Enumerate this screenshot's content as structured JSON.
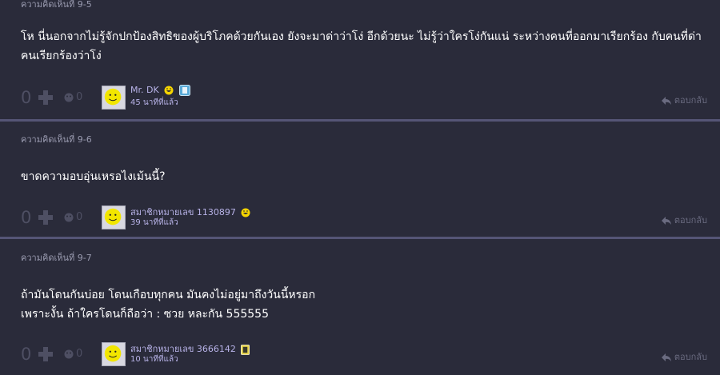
{
  "comments": [
    {
      "label": "ความคิดเห็นที่ 9-5",
      "text_lines": [
        "โห นี่นอกจากไม่รู้จักปกป้องสิทธิของผู้บริโภคด้วยกันเอง ยังจะมาด่าว่าโง่ อีกด้วยนะ ไม่รู้ว่าใครโง่กันแน่ ระหว่างคนที่ออกมาเรียกร้อง กับคนที่ด่า",
        "คนเรียกร้องว่าโง่"
      ],
      "votes": "0",
      "emotions": "0",
      "username": "Mr. DK",
      "timestamp": "45 นาทีที่แล้ว",
      "reply_label": "ตอบกลับ"
    },
    {
      "label": "ความคิดเห็นที่ 9-6",
      "text_lines": [
        "ขาดความอบอุ่นเหรอไงเม้นนี้?"
      ],
      "votes": "0",
      "emotions": "0",
      "username": "สมาชิกหมายเลข 1130897",
      "timestamp": "39 นาทีที่แล้ว",
      "reply_label": "ตอบกลับ"
    },
    {
      "label": "ความคิดเห็นที่ 9-7",
      "text_lines": [
        "ถ้ามันโดนกันบ่อย โดนเกือบทุกคน มันคงไม่อยู่มาถึงวันนี้หรอก",
        "เพราะงั้น ถ้าใครโดนก็ถือว่า : ซวย หละกัน 555555"
      ],
      "votes": "0",
      "emotions": "0",
      "username": "สมาชิกหมายเลข 3666142",
      "timestamp": "10 นาทีที่แล้ว",
      "reply_label": "ตอบกลับ"
    }
  ],
  "colors": {
    "background": "#2a2b3a",
    "divider": "#555576",
    "username": "#b8b3e8",
    "muted": "#4e4f63"
  },
  "icons": [
    "plus-icon",
    "emotion-icon",
    "smiley-avatar-icon",
    "laugh-emoji-icon",
    "badge-icon",
    "reply-arrow-icon"
  ]
}
